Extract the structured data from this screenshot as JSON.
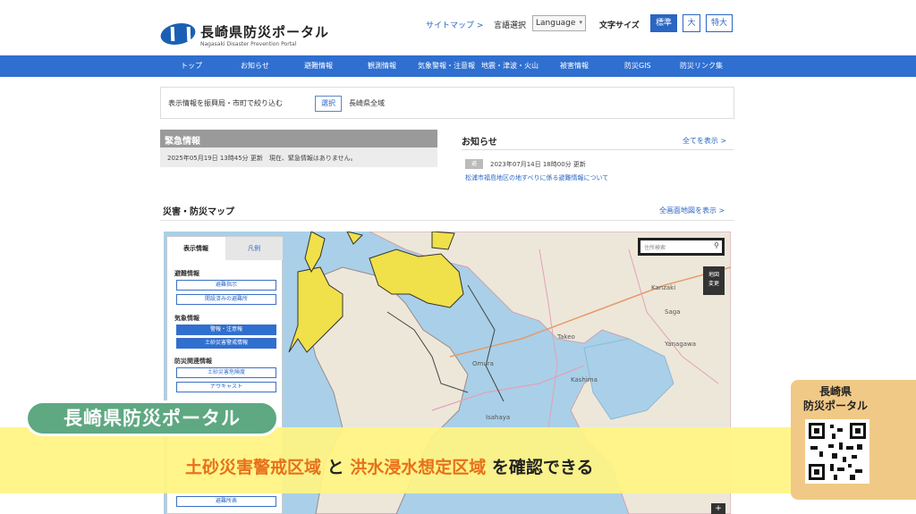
{
  "header": {
    "logo_title": "長崎県防災ポータル",
    "logo_subtitle": "Nagasaki Disaster Prevention Portal",
    "sitemap": "サイトマップ >",
    "language_label": "言語選択",
    "language_select": "Language",
    "font_size_label": "文字サイズ",
    "font_sizes": [
      "標準",
      "大",
      "特大"
    ]
  },
  "nav": {
    "items": [
      "トップ",
      "お知らせ",
      "避難情報",
      "観測情報",
      "気象警報・注意報",
      "地震・津波・火山",
      "被害情報",
      "防災GIS",
      "防災リンク集"
    ]
  },
  "filter": {
    "label": "表示情報を振興局・市町で絞り込む",
    "button": "選択",
    "value": "長崎県全域"
  },
  "emergency": {
    "title": "緊急情報",
    "message": "2025年05月19日 13時45分 更新　現在、緊急情報はありません。"
  },
  "notices": {
    "title": "お知らせ",
    "view_all": "全てを表示 >",
    "items": [
      {
        "badge": "避",
        "date": "2023年07月14日 18時00分 更新",
        "link": "松浦市福島地区の地すべりに係る避難情報について"
      }
    ]
  },
  "map_section": {
    "title": "災害・防災マップ",
    "full_link": "全画面地図を表示 >",
    "search_placeholder": "住所検索",
    "switch_label": "地図\n変更",
    "zoom_in": "+",
    "place_labels": [
      "Kanzaki",
      "Saga",
      "Takeo",
      "Kashima",
      "Yanagawa",
      "Isahaya",
      "Omura"
    ]
  },
  "map_panel": {
    "tabs": [
      "表示情報",
      "凡例"
    ],
    "groups": [
      {
        "title": "避難情報",
        "buttons": [
          {
            "label": "避難指示",
            "on": false
          },
          {
            "label": "開設済みの避難所",
            "on": false
          }
        ]
      },
      {
        "title": "気象情報",
        "buttons": [
          {
            "label": "警報・注意報",
            "on": true
          },
          {
            "label": "土砂災害警戒情報",
            "on": true
          }
        ]
      },
      {
        "title": "防災関連情報",
        "buttons": [
          {
            "label": "土砂災害危険度",
            "on": false
          },
          {
            "label": "ナウキャスト",
            "on": false
          }
        ]
      }
    ],
    "bottom_button": "避難所表"
  },
  "overlay": {
    "pill": "長崎県防災ポータル",
    "caption_parts": [
      "土砂災害警戒区域",
      " と ",
      "洪水浸水想定区域",
      " を確認できる"
    ],
    "qr_title": "長崎県\n防災ポータル"
  },
  "colors": {
    "brand_blue": "#2f6fd0",
    "highlight_orange": "#e8701a",
    "caption_yellow": "#fff482",
    "pill_green": "#5ea882",
    "warning_yellow": "#f0e04a"
  }
}
